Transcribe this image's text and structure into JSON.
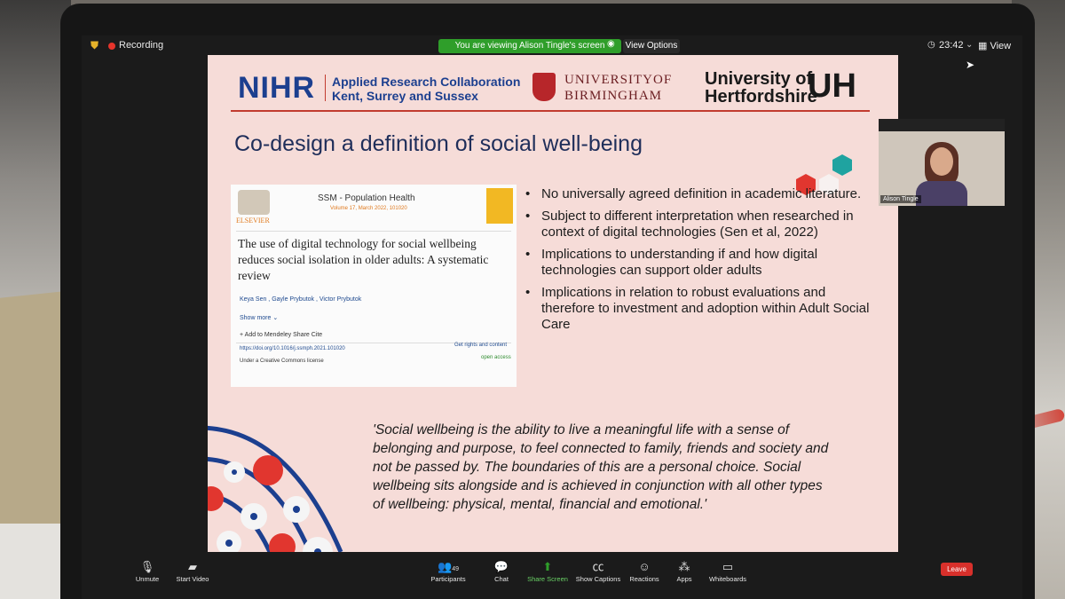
{
  "topbar": {
    "recording": "Recording",
    "viewing_banner": "You are viewing Alison Tingle's screen",
    "view_options": "View Options",
    "clock": "23:42",
    "view": "View"
  },
  "slide": {
    "logos": {
      "nihr": "NIHR",
      "arc_line1": "Applied Research Collaboration",
      "arc_line2": "Kent, Surrey and Sussex",
      "uob_line1": "UNIVERSITYOF",
      "uob_line2": "BIRMINGHAM",
      "uoh_line1": "University of",
      "uoh_line2": "Hertfordshire",
      "uoh_mark": "UH"
    },
    "title": "Co-design a definition of social well-being",
    "article": {
      "publisher": "ELSEVIER",
      "journal": "SSM - Population Health",
      "volume": "Volume 17, March 2022, 101020",
      "title": "The use of digital technology for social wellbeing reduces social isolation in older adults: A systematic review",
      "authors": "Keya Sen , Gayle Prybutok , Victor Prybutok",
      "show_more": "Show more",
      "mendeley": "+ Add to Mendeley   Share   Cite",
      "doi": "https://doi.org/10.1016/j.ssmph.2021.101020",
      "rights": "Get rights and content",
      "open_access": "open access",
      "license": "Under a Creative Commons license"
    },
    "bullets": [
      "No universally agreed definition in academic literature.",
      "Subject to different interpretation when researched in context of digital technologies (Sen et al, 2022)",
      "Implications to understanding if and how digital technologies can support older adults",
      "Implications in relation to robust evaluations and therefore to investment and adoption within Adult Social Care"
    ],
    "quote": "'Social wellbeing is the ability to live a meaningful life with a sense of belonging and purpose, to feel connected to family, friends and society and not be passed by. The boundaries of this are a personal choice. Social wellbeing sits alongside and is achieved in conjunction with all other types of wellbeing: physical, mental, financial and emotional.'"
  },
  "participant": {
    "name": "Alison Tingle"
  },
  "toolbar": {
    "unmute": "Unmute",
    "start_video": "Start Video",
    "participants": "Participants",
    "participants_count": "49",
    "chat": "Chat",
    "share_screen": "Share Screen",
    "show_captions": "Show Captions",
    "reactions": "Reactions",
    "apps": "Apps",
    "whiteboards": "Whiteboards",
    "leave": "Leave"
  },
  "colors": {
    "nihr_blue": "#1c3f8f",
    "accent_red": "#c23b2f",
    "share_green": "#2f9e2a",
    "leave_red": "#d8302b"
  }
}
